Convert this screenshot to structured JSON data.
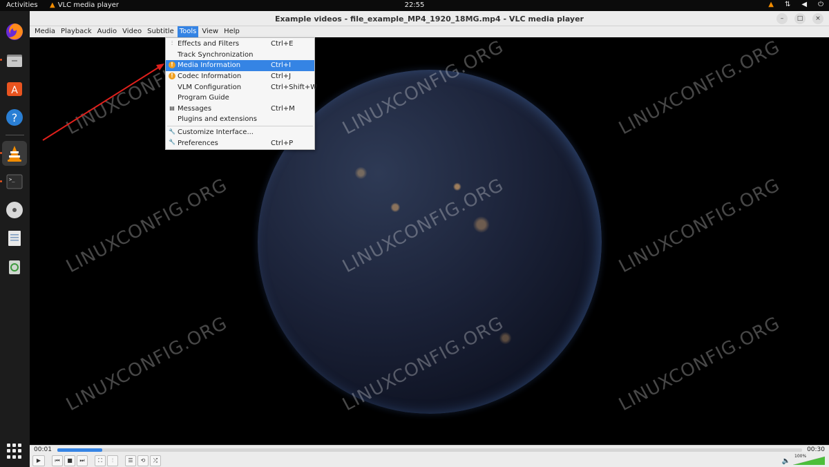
{
  "topbar": {
    "activities": "Activities",
    "app_name": "VLC media player",
    "clock": "22:55"
  },
  "window": {
    "title": "Example videos - file_example_MP4_1920_18MG.mp4 - VLC media player",
    "min": "–",
    "max": "□",
    "close": "×"
  },
  "menubar": {
    "items": [
      "Media",
      "Playback",
      "Audio",
      "Video",
      "Subtitle",
      "Tools",
      "View",
      "Help"
    ],
    "open": "Tools"
  },
  "tools_menu": {
    "items": [
      {
        "label": "Effects and Filters",
        "shortcut": "Ctrl+E",
        "icon": "equalizer-icon"
      },
      {
        "label": "Track Synchronization",
        "shortcut": "",
        "icon": ""
      },
      {
        "label": "Media Information",
        "shortcut": "Ctrl+I",
        "icon": "info-icon",
        "highlighted": true
      },
      {
        "label": "Codec Information",
        "shortcut": "Ctrl+J",
        "icon": "info-icon"
      },
      {
        "label": "VLM Configuration",
        "shortcut": "Ctrl+Shift+W",
        "icon": ""
      },
      {
        "label": "Program Guide",
        "shortcut": "",
        "icon": ""
      },
      {
        "label": "Messages",
        "shortcut": "Ctrl+M",
        "icon": "messages-icon"
      },
      {
        "label": "Plugins and extensions",
        "shortcut": "",
        "icon": ""
      },
      {
        "label": "Customize Interface...",
        "shortcut": "",
        "icon": "wrench-icon"
      },
      {
        "label": "Preferences",
        "shortcut": "Ctrl+P",
        "icon": "wrench-icon"
      }
    ]
  },
  "watermark": "LINUXCONFIG.ORG",
  "playback": {
    "elapsed": "00:01",
    "total": "00:30",
    "progress": 0.06,
    "volume_label": "100%",
    "volume": 1.0
  },
  "colors": {
    "accent": "#3584e4",
    "arrow": "#e0201c",
    "vlc_orange": "#f28c00"
  }
}
